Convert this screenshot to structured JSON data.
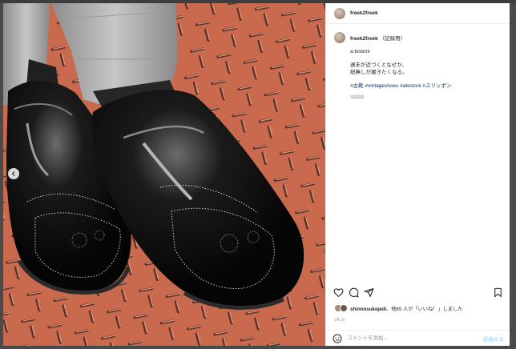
{
  "backdrop": {
    "caption": ""
  },
  "header": {
    "username": "freek2freek"
  },
  "caption": {
    "username": "freek2freek",
    "tag": "（記録用）",
    "brand_line": "a.testoni",
    "line1": "週末が近づくとなぜか、",
    "line2": "紐無しが履きたくなる。",
    "hashtags": "#古靴 #vintageshoes #atestoni #スリッポン",
    "time_ago": "9週間前"
  },
  "actions": {
    "like_icon": "heart-icon",
    "comment_icon": "comment-icon",
    "share_icon": "share-icon",
    "save_icon": "bookmark-icon"
  },
  "likes": {
    "user": "shinnosukejedi",
    "rest": "、他65 人が「いいね！」しました"
  },
  "post_date": "4月 28",
  "comment": {
    "placeholder": "コメントを追加...",
    "post_label": "投稿する"
  },
  "colors": {
    "accent": "#0095f6",
    "hashtag": "#00376b",
    "floor": "#c8694d",
    "shoe": "#0d0d0d"
  }
}
